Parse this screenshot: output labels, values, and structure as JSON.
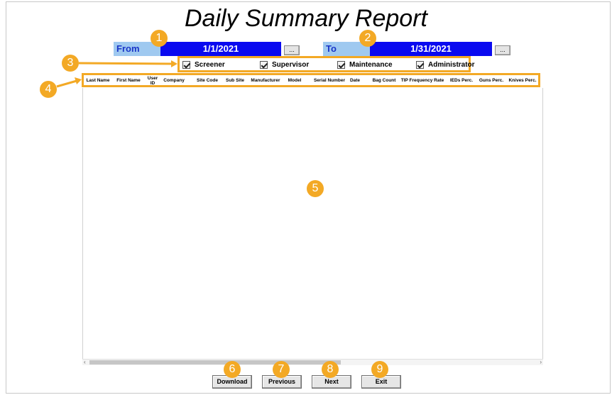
{
  "title": "Daily Summary Report",
  "from": {
    "label": "From",
    "date": "1/1/2021",
    "picker_label": "..."
  },
  "to": {
    "label": "To",
    "date": "1/31/2021",
    "picker_label": "..."
  },
  "roles": [
    {
      "label": "Screener",
      "checked": true
    },
    {
      "label": "Supervisor",
      "checked": true
    },
    {
      "label": "Maintenance",
      "checked": true
    },
    {
      "label": "Administrator",
      "checked": true
    }
  ],
  "columns": [
    "Last Name",
    "First Name",
    "User ID",
    "Company",
    "Site Code",
    "Sub Site",
    "Manufacturer",
    "Model",
    "Serial Number",
    "Date",
    "Bag Count",
    "TIP Frequency Rate",
    "IEDs Perc.",
    "Guns Perc.",
    "Knives Perc."
  ],
  "buttons": {
    "download": "Download",
    "previous": "Previous",
    "next": "Next",
    "exit": "Exit"
  },
  "callouts": [
    "1",
    "2",
    "3",
    "4",
    "5",
    "6",
    "7",
    "8",
    "9"
  ],
  "colors": {
    "callout": "#f3a925",
    "date_bg": "#0a0af0",
    "label_bg": "#9fc9f0"
  }
}
